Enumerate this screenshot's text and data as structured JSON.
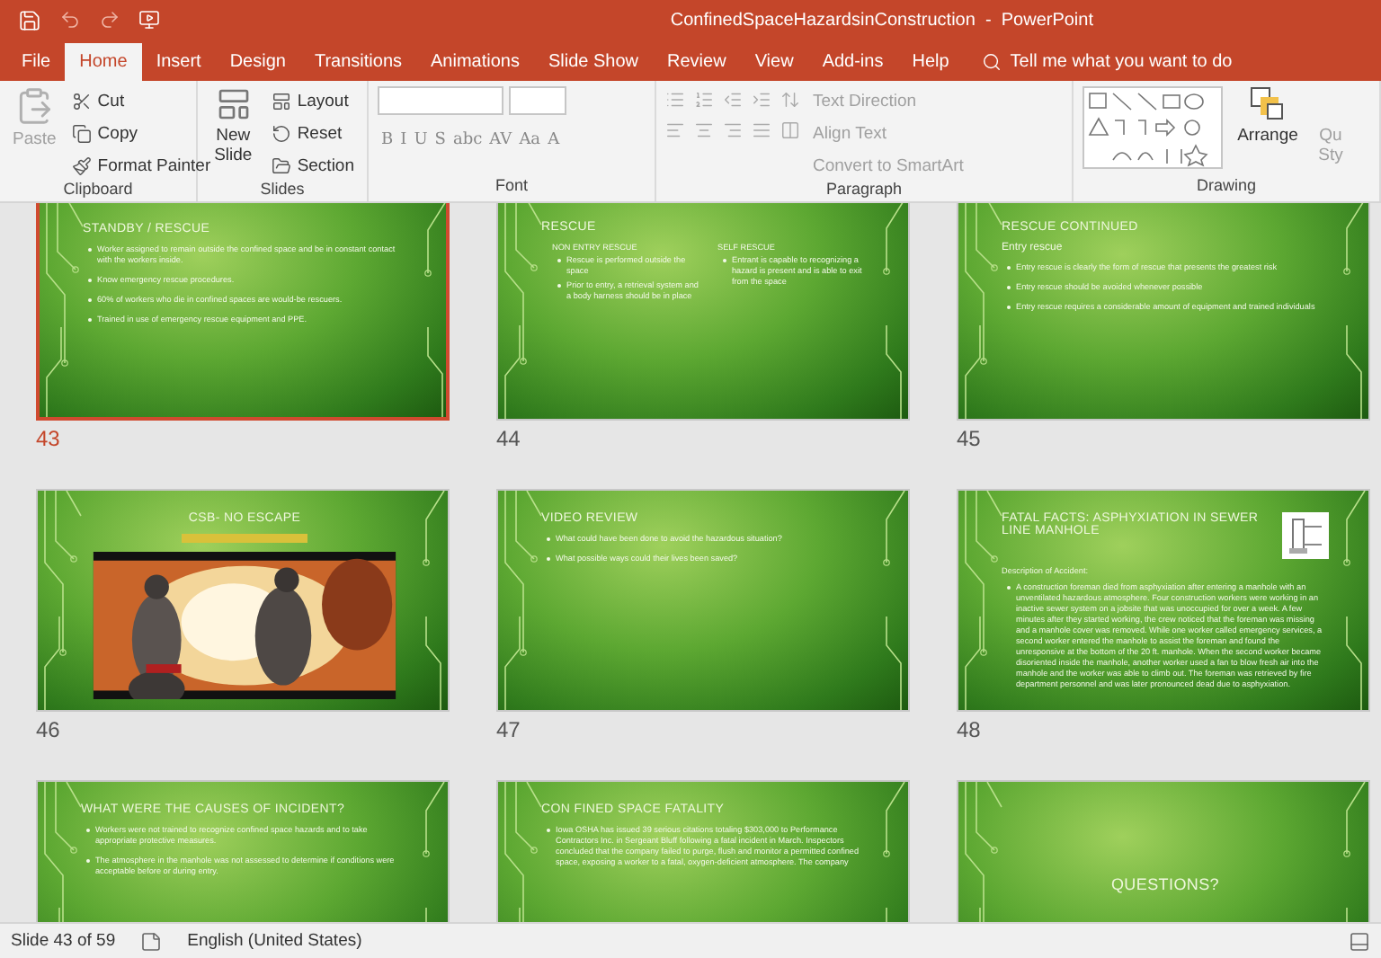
{
  "title_bar": {
    "title": "ConfinedSpaceHazardsinConstruction  -  PowerPoint"
  },
  "tabs": [
    {
      "label": "File",
      "selected": false
    },
    {
      "label": "Home",
      "selected": true
    },
    {
      "label": "Insert",
      "selected": false
    },
    {
      "label": "Design",
      "selected": false
    },
    {
      "label": "Transitions",
      "selected": false
    },
    {
      "label": "Animations",
      "selected": false
    },
    {
      "label": "Slide Show",
      "selected": false
    },
    {
      "label": "Review",
      "selected": false
    },
    {
      "label": "View",
      "selected": false
    },
    {
      "label": "Add-ins",
      "selected": false
    },
    {
      "label": "Help",
      "selected": false
    }
  ],
  "tell_me": {
    "placeholder": "Tell me what you want to do"
  },
  "ribbon": {
    "clipboard": {
      "label": "Clipboard",
      "paste": "Paste",
      "items": [
        "Cut",
        "Copy",
        "Format Painter"
      ]
    },
    "slides": {
      "label": "Slides",
      "new_slide": "New Slide",
      "items": [
        "Layout",
        "Reset",
        "Section"
      ]
    },
    "font": {
      "label": "Font",
      "buttons": [
        "B",
        "I",
        "U",
        "S",
        "abc",
        "AV",
        "Aa",
        "A"
      ]
    },
    "paragraph": {
      "label": "Paragraph",
      "items": [
        "Text Direction",
        "Align Text",
        "Convert to SmartArt"
      ]
    },
    "drawing": {
      "label": "Drawing",
      "arrange": "Arrange",
      "quick_styles": "Qu Sty"
    }
  },
  "slides": [
    {
      "number": "43",
      "selected": true,
      "kind": "bullets",
      "title": "STANDBY / RESCUE",
      "bullets": [
        "Worker assigned to remain outside the confined space and be in constant contact with the workers inside.",
        "Know emergency rescue procedures.",
        "60% of workers who die in confined spaces are would-be rescuers.",
        "Trained in use of emergency rescue equipment and PPE."
      ]
    },
    {
      "number": "44",
      "selected": false,
      "kind": "two_column",
      "title": "RESCUE",
      "columns": [
        {
          "heading": "NON ENTRY RESCUE",
          "bullets": [
            "Rescue is performed outside the space",
            "Prior to entry, a retrieval system and a body harness should be in place"
          ]
        },
        {
          "heading": "SELF RESCUE",
          "bullets": [
            "Entrant is capable to recognizing a hazard is present and is able to exit from the space"
          ]
        }
      ]
    },
    {
      "number": "45",
      "selected": false,
      "kind": "bullets",
      "title": "RESCUE CONTINUED",
      "subtitle": "Entry rescue",
      "bullets": [
        "Entry rescue is clearly the form of rescue that presents the greatest risk",
        "Entry rescue should be avoided whenever possible",
        "Entry rescue requires a considerable amount of equipment and trained individuals"
      ]
    },
    {
      "number": "46",
      "selected": false,
      "kind": "video",
      "title": "CSB- NO ESCAPE"
    },
    {
      "number": "47",
      "selected": false,
      "kind": "bullets",
      "title": "VIDEO REVIEW",
      "bullets": [
        "What could have been done to avoid the hazardous situation?",
        "What possible ways could their lives been saved?"
      ]
    },
    {
      "number": "48",
      "selected": false,
      "kind": "facts",
      "title": "FATAL FACTS: ASPHYXIATION IN SEWER LINE MANHOLE",
      "subtitle": "Description of Accident:",
      "bullets": [
        "A construction foreman died from asphyxiation after entering a manhole with an unventilated hazardous atmosphere. Four construction workers were working in an inactive sewer system on a jobsite that was unoccupied for over a week. A few minutes after they started working, the crew noticed that the foreman was missing and a manhole cover was removed. While one worker called emergency services, a second worker entered the manhole to assist the foreman and found the unresponsive at the bottom of the 20 ft. manhole. When the second worker became disoriented inside the manhole, another worker used a fan to blow fresh air into the manhole and the worker was able to climb out. The foreman was retrieved by fire department personnel and was later pronounced dead due to asphyxiation."
      ]
    },
    {
      "selected": false,
      "kind": "bullets",
      "title": "WHAT WERE THE CAUSES OF INCIDENT?",
      "bullets": [
        "Workers were not trained to recognize confined space hazards and to take appropriate protective measures.",
        "The atmosphere in the manhole was not assessed to determine if conditions were acceptable before or during entry."
      ]
    },
    {
      "selected": false,
      "kind": "bullets",
      "title": "CON FINED SPACE FATALITY",
      "bullets": [
        "Iowa OSHA has issued 39 serious citations totaling $303,000 to Performance Contractors Inc. in Sergeant Bluff following a fatal incident in March. Inspectors concluded that the company failed to purge, flush and monitor a permitted confined space, exposing a worker to a fatal, oxygen-deficient atmosphere. The company"
      ]
    },
    {
      "selected": false,
      "kind": "closing",
      "title": "QUESTIONS?"
    }
  ],
  "status_bar": {
    "slide": "Slide 43 of 59",
    "language": "English (United States)"
  }
}
